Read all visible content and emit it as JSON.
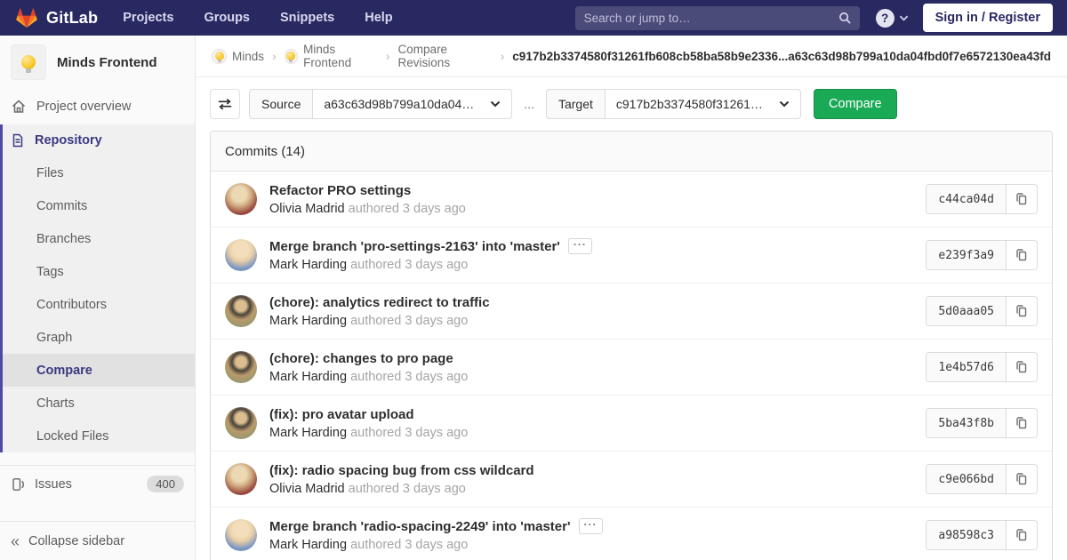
{
  "navbar": {
    "brand": "GitLab",
    "menu": [
      "Projects",
      "Groups",
      "Snippets",
      "Help"
    ],
    "search_placeholder": "Search or jump to…",
    "help_glyph": "?",
    "signin_label": "Sign in / Register"
  },
  "sidebar": {
    "project_title": "Minds Frontend",
    "overview_label": "Project overview",
    "repository_label": "Repository",
    "repo_items": [
      "Files",
      "Commits",
      "Branches",
      "Tags",
      "Contributors",
      "Graph",
      "Compare",
      "Charts",
      "Locked Files"
    ],
    "active_item": "Compare",
    "issues_label": "Issues",
    "issues_count": "400",
    "collapse_glyph": "«",
    "collapse_label": "Collapse sidebar"
  },
  "breadcrumb": {
    "sep": "›",
    "group_label": "Minds",
    "project_label": "Minds Frontend",
    "section_label": "Compare Revisions",
    "current": "c917b2b3374580f31261fb608cb58ba58b9e2336...a63c63d98b799a10da04fbd0f7e6572130ea43fd"
  },
  "compare_form": {
    "source_label": "Source",
    "source_value": "a63c63d98b799a10da04…",
    "separator": "...",
    "target_label": "Target",
    "target_value": "c917b2b3374580f31261…",
    "compare_button": "Compare"
  },
  "commits_panel": {
    "header": "Commits (14)",
    "expander_glyph": "···",
    "commits": [
      {
        "title": "Refactor PRO settings",
        "author": "Olivia Madrid",
        "authored": "authored 3 days ago",
        "sha": "c44ca04d"
      },
      {
        "title": "Merge branch 'pro-settings-2163' into 'master'",
        "author": "Mark Harding",
        "authored": "authored 3 days ago",
        "sha": "e239f3a9"
      },
      {
        "title": "(chore): analytics redirect to traffic",
        "author": "Mark Harding",
        "authored": "authored 3 days ago",
        "sha": "5d0aaa05"
      },
      {
        "title": "(chore): changes to pro page",
        "author": "Mark Harding",
        "authored": "authored 3 days ago",
        "sha": "1e4b57d6"
      },
      {
        "title": "(fix): pro avatar upload",
        "author": "Mark Harding",
        "authored": "authored 3 days ago",
        "sha": "5ba43f8b"
      },
      {
        "title": "(fix): radio spacing bug from css wildcard",
        "author": "Olivia Madrid",
        "authored": "authored 3 days ago",
        "sha": "c9e066bd"
      },
      {
        "title": "Merge branch 'radio-spacing-2249' into 'master'",
        "author": "Mark Harding",
        "authored": "authored 3 days ago",
        "sha": "a98598c3"
      }
    ]
  },
  "colors": {
    "navbar_bg": "#292961",
    "sidebar_accent_border": "#4b4ba3",
    "sidebar_active_text": "#393982",
    "compare_button_green": "#1aaa55"
  }
}
